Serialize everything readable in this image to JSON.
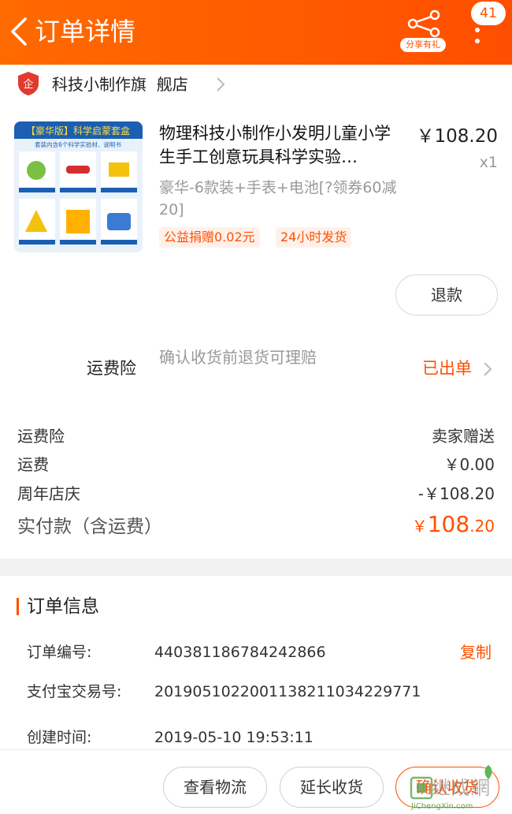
{
  "header": {
    "title": "订单详情",
    "share_label": "分享有礼",
    "message_count": "41",
    "bg_color": "#ff5a00"
  },
  "shop": {
    "name": "科技小制作旗  舰店",
    "logo_text": "企"
  },
  "product": {
    "title": "物理科技小制作小发明儿童小学生手工创意玩具科学实验…",
    "price": "￥108.20",
    "quantity": "x1",
    "sku": "豪华-6款装+手表+电池[?领券60减20]",
    "tags": [
      "公益捐赠0.02元",
      "24小时发货"
    ],
    "refund_label": "退款",
    "image_header": "【豪华版】科学启蒙套盒",
    "image_subheader": "套装内含6个科学实验材、说明书"
  },
  "insurance": {
    "label": "运费险",
    "description": "确认收货前退货可理赔",
    "status": "已出单"
  },
  "costs": [
    {
      "label": "运费险",
      "value": "卖家赠送"
    },
    {
      "label": "运费",
      "value": "￥0.00"
    },
    {
      "label": "周年店庆",
      "value": "-￥108.20"
    }
  ],
  "total": {
    "label": "实付款（含运费）",
    "currency": "￥",
    "integer": "108",
    "decimal": ".20"
  },
  "order_info": {
    "title": "订单信息",
    "rows": [
      {
        "label": "订单编号:",
        "value": "440381186784242866",
        "action": "复制"
      },
      {
        "label": "支付宝交易号:",
        "value": "2019051022001138211034229771"
      },
      {
        "label": "创建时间:",
        "value": "2019-05-10 19:53:11"
      }
    ]
  },
  "actions": {
    "logistics": "查看物流",
    "extend": "延长收货",
    "confirm": "确认收货"
  },
  "watermark": {
    "text": "继成網",
    "sub": "JiChengXin.com"
  }
}
